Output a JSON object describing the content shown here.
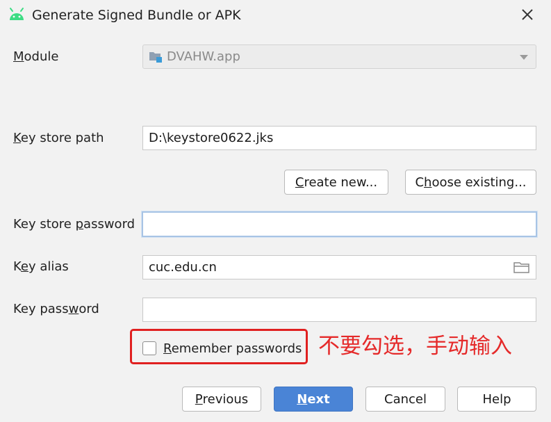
{
  "window": {
    "title": "Generate Signed Bundle or APK",
    "icon": "android-icon",
    "close_icon": "close-icon"
  },
  "form": {
    "module": {
      "label_pre": "",
      "label_key": "M",
      "label_post": "odule",
      "value": "DVAHW.app",
      "disabled": true
    },
    "key_store_path": {
      "label_pre": "",
      "label_key": "K",
      "label_post": "ey store path",
      "value": "D:\\keystore0622.jks"
    },
    "create_new": {
      "pre": "",
      "key": "C",
      "post": "reate new..."
    },
    "choose_existing": {
      "pre": "C",
      "key": "h",
      "post": "oose existing..."
    },
    "key_store_password": {
      "label_pre": "Key store ",
      "label_key": "p",
      "label_post": "assword",
      "value": ""
    },
    "key_alias": {
      "label_pre": "K",
      "label_key": "e",
      "label_post": "y alias",
      "value": "cuc.edu.cn"
    },
    "key_password": {
      "label_pre": "Key pass",
      "label_key": "w",
      "label_post": "ord",
      "value": ""
    },
    "remember_passwords": {
      "pre": "",
      "key": "R",
      "post": "emember passwords",
      "checked": false
    }
  },
  "annotation": {
    "text": "不要勾选，手动输入",
    "color": "#e02020"
  },
  "footer": {
    "previous": {
      "pre": "",
      "key": "P",
      "post": "revious"
    },
    "next": {
      "pre": "",
      "key": "N",
      "post": "ext"
    },
    "cancel": "Cancel",
    "help": "Help"
  },
  "colors": {
    "primary_button": "#4a84d6",
    "focus_border": "#a8c4e5",
    "background": "#f2f2f2"
  }
}
